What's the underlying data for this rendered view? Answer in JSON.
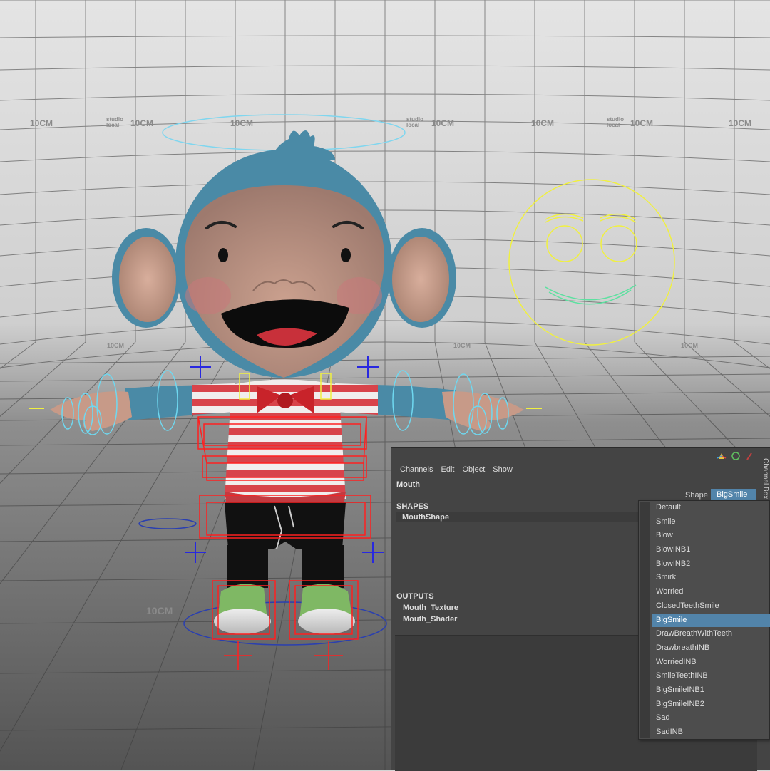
{
  "viewport": {
    "grid_labels": [
      "10CM",
      "10CM",
      "10CM",
      "10CM",
      "10CM",
      "10CM",
      "10CM",
      "10CM",
      "10CM",
      "10CM",
      "10CM"
    ],
    "logo_text": [
      "studio",
      "local"
    ],
    "character": "monkey rig",
    "colors": {
      "grid_bg_top": "#e2e2e2",
      "grid_bg_bottom": "#5a5a5a",
      "fur": "#4a8aa6",
      "skin": "#c79a88",
      "shirt_red": "#d8434a",
      "controller_yellow": "#f0f040",
      "controller_green": "#5de0a0",
      "controller_cyan": "#6fd8f0",
      "controller_red": "#ff2020",
      "controller_blue": "#2020e0"
    }
  },
  "channel_box": {
    "title": "Channel Box",
    "menus": [
      "Channels",
      "Edit",
      "Object",
      "Show"
    ],
    "object_name": "Mouth",
    "shape_label": "Shape",
    "shape_value": "BigSmile",
    "shapes_header": "SHAPES",
    "shape_node": "MouthShape",
    "outputs_header": "OUTPUTS",
    "outputs": [
      "Mouth_Texture",
      "Mouth_Shader"
    ],
    "icons": [
      "move-tool-icon",
      "circle-tool-icon",
      "pin-icon"
    ]
  },
  "dropdown": {
    "options": [
      "Default",
      "Smile",
      "Blow",
      "BlowINB1",
      "BlowINB2",
      "Smirk",
      "Worried",
      "ClosedTeethSmile",
      "BigSmile",
      "DrawBreathWithTeeth",
      "DrawbreathINB",
      "WorriedINB",
      "SmileTeethINB",
      "BigSmileINB1",
      "BigSmileINB2",
      "Sad",
      "SadINB"
    ],
    "selected": "BigSmile"
  }
}
